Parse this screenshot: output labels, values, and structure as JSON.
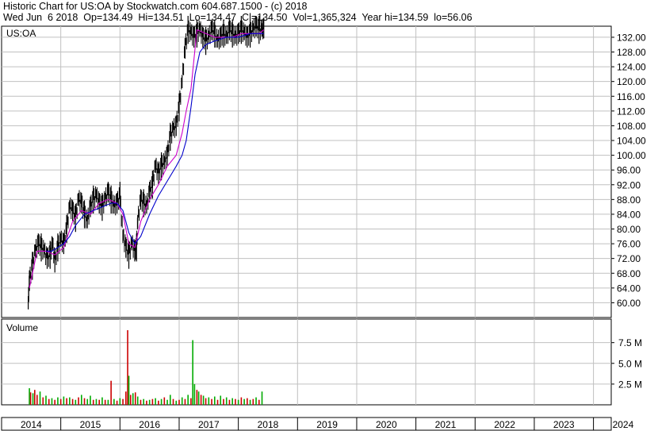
{
  "header": {
    "line1": "Historic Chart for US:OA by Stockwatch.com 604.687.1500 - (c) 2018",
    "line2": "Wed Jun  6 2018  Op=134.49  Hi=134.51  Lo=134.47  Cl=134.50  Vol=1,365,324  Year hi=134.59  lo=56.06"
  },
  "chart_data": [
    {
      "type": "line",
      "title": "US:OA",
      "colors": {
        "price": "#000000",
        "ma_short": "#cc00cc",
        "ma_long": "#0000cc",
        "grid": "#c0c0c0"
      },
      "ylim": [
        56,
        135
      ],
      "y_ticks": [
        "132.00",
        "128.00",
        "124.00",
        "120.00",
        "116.00",
        "112.00",
        "108.00",
        "104.00",
        "100.00",
        "96.00",
        "92.00",
        "88.00",
        "84.00",
        "80.00",
        "76.00",
        "72.00",
        "68.00",
        "64.00",
        "60.00"
      ],
      "x_range": [
        2014.0,
        2024.3
      ],
      "series": [
        {
          "role": "price",
          "x": [
            2014.45,
            2014.47,
            2014.52,
            2014.57,
            2014.62,
            2014.67,
            2014.72,
            2014.77,
            2014.82,
            2014.86,
            2014.9,
            2014.95,
            2015.0,
            2015.05,
            2015.1,
            2015.15,
            2015.2,
            2015.25,
            2015.3,
            2015.35,
            2015.4,
            2015.45,
            2015.5,
            2015.55,
            2015.6,
            2015.65,
            2015.7,
            2015.75,
            2015.8,
            2015.85,
            2015.9,
            2015.95,
            2016.0,
            2016.05,
            2016.1,
            2016.15,
            2016.2,
            2016.25,
            2016.28,
            2016.3,
            2016.35,
            2016.4,
            2016.45,
            2016.5,
            2016.55,
            2016.6,
            2016.65,
            2016.7,
            2016.75,
            2016.8,
            2016.85,
            2016.9,
            2016.95,
            2017.0,
            2017.05,
            2017.1,
            2017.15,
            2017.2,
            2017.25,
            2017.3,
            2017.35,
            2017.4,
            2017.45,
            2017.5,
            2017.55,
            2017.6,
            2017.65,
            2017.7,
            2017.75,
            2017.8,
            2017.85,
            2017.9,
            2017.95,
            2018.0,
            2018.05,
            2018.1,
            2018.15,
            2018.2,
            2018.25,
            2018.3,
            2018.35,
            2018.4,
            2018.43
          ],
          "values": [
            60,
            66,
            70,
            74,
            76,
            75,
            74,
            72,
            73,
            76,
            71,
            75,
            77,
            76,
            80,
            86,
            85,
            83,
            88,
            87,
            84,
            82,
            86,
            88,
            89,
            87,
            86,
            88,
            90,
            88,
            86,
            87,
            89,
            78,
            75,
            73,
            76,
            74,
            75,
            82,
            88,
            87,
            86,
            90,
            92,
            97,
            95,
            97,
            98,
            100,
            105,
            107,
            108,
            113,
            120,
            129,
            134,
            133,
            132,
            133,
            134,
            132,
            131,
            132,
            134,
            133,
            131,
            132,
            133,
            132,
            134,
            133,
            132,
            133,
            134,
            133,
            132,
            133,
            134,
            135,
            134,
            134,
            134.5
          ]
        },
        {
          "role": "ma_short",
          "x": [
            2014.47,
            2014.6,
            2014.75,
            2014.9,
            2015.05,
            2015.2,
            2015.35,
            2015.5,
            2015.65,
            2015.8,
            2015.95,
            2016.05,
            2016.15,
            2016.25,
            2016.35,
            2016.5,
            2016.65,
            2016.8,
            2016.95,
            2017.05,
            2017.12,
            2017.2,
            2017.3,
            2017.45,
            2017.6,
            2017.75,
            2017.9,
            2018.05,
            2018.2,
            2018.35,
            2018.43
          ],
          "values": [
            64,
            74,
            74,
            73,
            75,
            82,
            85,
            84,
            87,
            88,
            87,
            84,
            76,
            75,
            82,
            88,
            92,
            97,
            100,
            106,
            112,
            118,
            134,
            133,
            132,
            132,
            132,
            133,
            133,
            133,
            134
          ]
        },
        {
          "role": "ma_long",
          "x": [
            2014.75,
            2014.85,
            2014.95,
            2015.05,
            2015.15,
            2015.25,
            2015.4,
            2015.55,
            2015.7,
            2015.85,
            2015.95,
            2016.05,
            2016.15,
            2016.25,
            2016.35,
            2016.5,
            2016.65,
            2016.8,
            2016.95,
            2017.05,
            2017.12,
            2017.2,
            2017.27,
            2017.35,
            2017.45,
            2017.6,
            2017.8,
            2018.0,
            2018.2,
            2018.43
          ],
          "values": [
            74,
            74,
            75,
            76,
            78,
            81,
            84,
            85,
            86,
            87,
            87,
            85,
            79,
            76,
            78,
            84,
            89,
            93,
            97,
            100,
            104,
            113,
            122,
            128,
            130,
            131,
            132,
            132,
            133,
            133
          ]
        }
      ]
    },
    {
      "type": "bar",
      "title": "Volume",
      "ylim": [
        0,
        9000000
      ],
      "y_ticks": [
        "7.5 M",
        "5.0 M",
        "2.5 M"
      ],
      "colors": {
        "up": "#00aa00",
        "down": "#cc0000",
        "grid": "#c0c0c0"
      },
      "bars": [
        {
          "x": 2014.47,
          "v": 2000000,
          "c": "up"
        },
        {
          "x": 2014.49,
          "v": 1500000,
          "c": "down"
        },
        {
          "x": 2014.53,
          "v": 1400000,
          "c": "up"
        },
        {
          "x": 2014.56,
          "v": 1800000,
          "c": "down"
        },
        {
          "x": 2014.6,
          "v": 1200000,
          "c": "down"
        },
        {
          "x": 2014.65,
          "v": 1600000,
          "c": "up"
        },
        {
          "x": 2014.7,
          "v": 900000,
          "c": "down"
        },
        {
          "x": 2014.75,
          "v": 1100000,
          "c": "up"
        },
        {
          "x": 2014.8,
          "v": 700000,
          "c": "down"
        },
        {
          "x": 2014.85,
          "v": 800000,
          "c": "up"
        },
        {
          "x": 2014.9,
          "v": 600000,
          "c": "down"
        },
        {
          "x": 2014.95,
          "v": 900000,
          "c": "up"
        },
        {
          "x": 2015.0,
          "v": 700000,
          "c": "down"
        },
        {
          "x": 2015.05,
          "v": 1000000,
          "c": "up"
        },
        {
          "x": 2015.1,
          "v": 800000,
          "c": "down"
        },
        {
          "x": 2015.15,
          "v": 900000,
          "c": "up"
        },
        {
          "x": 2015.2,
          "v": 700000,
          "c": "down"
        },
        {
          "x": 2015.25,
          "v": 600000,
          "c": "up"
        },
        {
          "x": 2015.3,
          "v": 900000,
          "c": "down"
        },
        {
          "x": 2015.35,
          "v": 1200000,
          "c": "up"
        },
        {
          "x": 2015.4,
          "v": 800000,
          "c": "down"
        },
        {
          "x": 2015.45,
          "v": 700000,
          "c": "up"
        },
        {
          "x": 2015.5,
          "v": 1100000,
          "c": "up"
        },
        {
          "x": 2015.55,
          "v": 600000,
          "c": "down"
        },
        {
          "x": 2015.6,
          "v": 700000,
          "c": "up"
        },
        {
          "x": 2015.65,
          "v": 600000,
          "c": "down"
        },
        {
          "x": 2015.7,
          "v": 900000,
          "c": "up"
        },
        {
          "x": 2015.75,
          "v": 600000,
          "c": "down"
        },
        {
          "x": 2015.8,
          "v": 600000,
          "c": "up"
        },
        {
          "x": 2015.85,
          "v": 2900000,
          "c": "down"
        },
        {
          "x": 2015.9,
          "v": 700000,
          "c": "up"
        },
        {
          "x": 2015.95,
          "v": 500000,
          "c": "down"
        },
        {
          "x": 2016.0,
          "v": 800000,
          "c": "up"
        },
        {
          "x": 2016.05,
          "v": 700000,
          "c": "down"
        },
        {
          "x": 2016.1,
          "v": 1600000,
          "c": "down"
        },
        {
          "x": 2016.13,
          "v": 9000000,
          "c": "down"
        },
        {
          "x": 2016.15,
          "v": 3500000,
          "c": "up"
        },
        {
          "x": 2016.18,
          "v": 1200000,
          "c": "down"
        },
        {
          "x": 2016.22,
          "v": 1400000,
          "c": "up"
        },
        {
          "x": 2016.26,
          "v": 1500000,
          "c": "down"
        },
        {
          "x": 2016.3,
          "v": 1000000,
          "c": "up"
        },
        {
          "x": 2016.35,
          "v": 600000,
          "c": "down"
        },
        {
          "x": 2016.4,
          "v": 700000,
          "c": "up"
        },
        {
          "x": 2016.45,
          "v": 500000,
          "c": "down"
        },
        {
          "x": 2016.5,
          "v": 600000,
          "c": "up"
        },
        {
          "x": 2016.55,
          "v": 700000,
          "c": "down"
        },
        {
          "x": 2016.6,
          "v": 800000,
          "c": "up"
        },
        {
          "x": 2016.65,
          "v": 500000,
          "c": "down"
        },
        {
          "x": 2016.7,
          "v": 700000,
          "c": "up"
        },
        {
          "x": 2016.75,
          "v": 900000,
          "c": "down"
        },
        {
          "x": 2016.8,
          "v": 600000,
          "c": "up"
        },
        {
          "x": 2016.85,
          "v": 1200000,
          "c": "up"
        },
        {
          "x": 2016.9,
          "v": 700000,
          "c": "down"
        },
        {
          "x": 2016.95,
          "v": 500000,
          "c": "up"
        },
        {
          "x": 2017.0,
          "v": 600000,
          "c": "down"
        },
        {
          "x": 2017.05,
          "v": 900000,
          "c": "up"
        },
        {
          "x": 2017.1,
          "v": 700000,
          "c": "down"
        },
        {
          "x": 2017.15,
          "v": 1200000,
          "c": "up"
        },
        {
          "x": 2017.2,
          "v": 800000,
          "c": "down"
        },
        {
          "x": 2017.23,
          "v": 7800000,
          "c": "up"
        },
        {
          "x": 2017.26,
          "v": 2500000,
          "c": "up"
        },
        {
          "x": 2017.3,
          "v": 1800000,
          "c": "down"
        },
        {
          "x": 2017.33,
          "v": 1600000,
          "c": "up"
        },
        {
          "x": 2017.37,
          "v": 1200000,
          "c": "down"
        },
        {
          "x": 2017.41,
          "v": 1100000,
          "c": "up"
        },
        {
          "x": 2017.45,
          "v": 800000,
          "c": "down"
        },
        {
          "x": 2017.5,
          "v": 900000,
          "c": "up"
        },
        {
          "x": 2017.55,
          "v": 700000,
          "c": "down"
        },
        {
          "x": 2017.6,
          "v": 1000000,
          "c": "up"
        },
        {
          "x": 2017.65,
          "v": 600000,
          "c": "down"
        },
        {
          "x": 2017.7,
          "v": 1100000,
          "c": "up"
        },
        {
          "x": 2017.75,
          "v": 700000,
          "c": "down"
        },
        {
          "x": 2017.8,
          "v": 900000,
          "c": "up"
        },
        {
          "x": 2017.85,
          "v": 600000,
          "c": "down"
        },
        {
          "x": 2017.9,
          "v": 800000,
          "c": "up"
        },
        {
          "x": 2017.95,
          "v": 700000,
          "c": "down"
        },
        {
          "x": 2018.0,
          "v": 600000,
          "c": "up"
        },
        {
          "x": 2018.05,
          "v": 900000,
          "c": "down"
        },
        {
          "x": 2018.1,
          "v": 700000,
          "c": "up"
        },
        {
          "x": 2018.15,
          "v": 800000,
          "c": "down"
        },
        {
          "x": 2018.2,
          "v": 600000,
          "c": "up"
        },
        {
          "x": 2018.25,
          "v": 700000,
          "c": "down"
        },
        {
          "x": 2018.3,
          "v": 900000,
          "c": "up"
        },
        {
          "x": 2018.35,
          "v": 600000,
          "c": "down"
        },
        {
          "x": 2018.4,
          "v": 1600000,
          "c": "up"
        }
      ]
    }
  ],
  "x_axis": {
    "labels": [
      "2014",
      "2015",
      "2016",
      "2017",
      "2018",
      "2019",
      "2020",
      "2021",
      "2022",
      "2023",
      "2024"
    ]
  }
}
